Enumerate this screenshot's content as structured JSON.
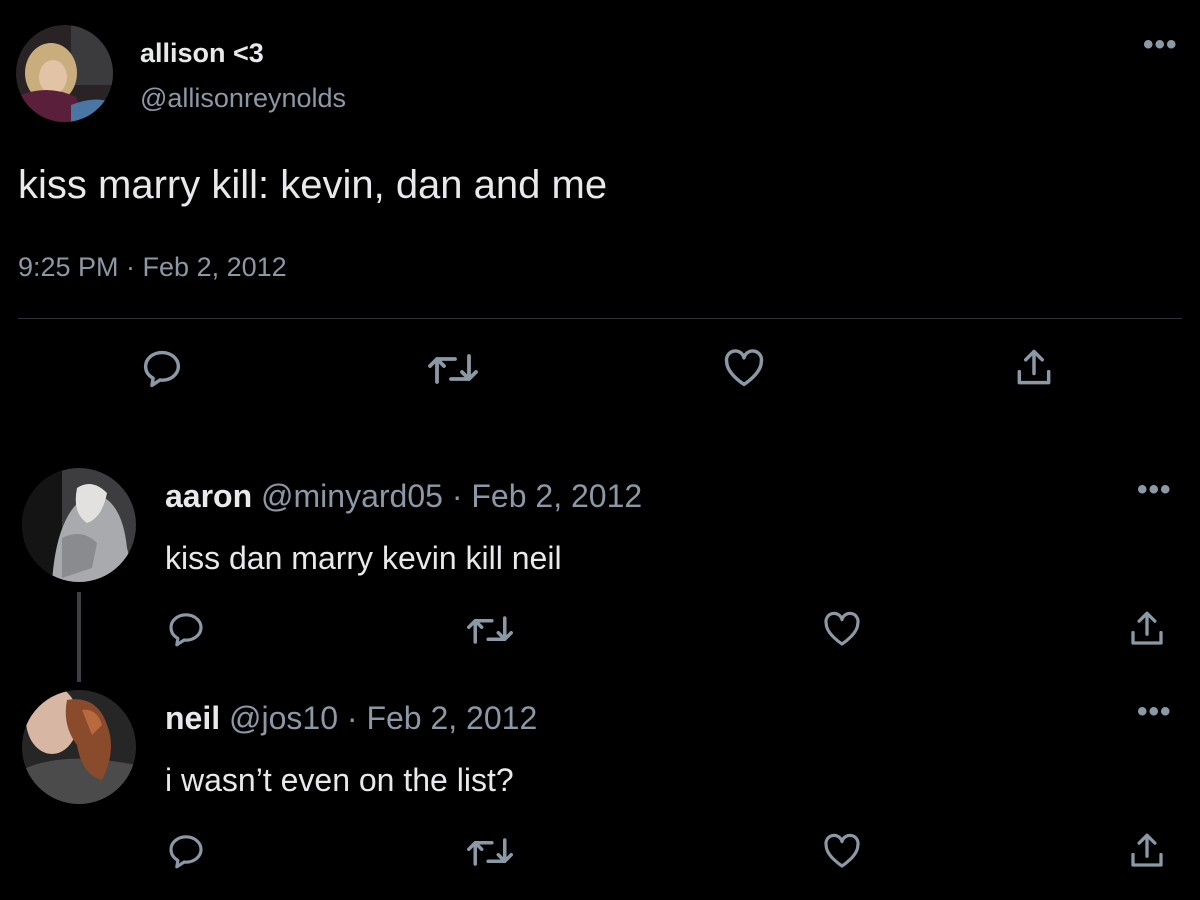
{
  "main_tweet": {
    "display_name": "allison <3",
    "handle": "@allisonreynolds",
    "text": "kiss marry kill: kevin, dan and me",
    "timestamp": "9:25 PM · Feb 2, 2012",
    "more_label": "•••"
  },
  "replies": [
    {
      "display_name": "aaron",
      "handle": "@minyard05",
      "separator": "·",
      "date": "Feb 2, 2012",
      "text": "kiss dan marry kevin kill neil",
      "more_label": "•••"
    },
    {
      "display_name": "neil",
      "handle": "@jos10",
      "separator": "·",
      "date": "Feb 2, 2012",
      "text": "i wasn’t even on the list?",
      "more_label": "•••"
    }
  ],
  "icons": {
    "reply": "reply-icon",
    "retweet": "retweet-icon",
    "like": "heart-icon",
    "share": "share-icon"
  },
  "colors": {
    "background": "#000000",
    "text": "#e7e9ea",
    "muted": "#8b98a5",
    "divider": "#2f3336"
  }
}
